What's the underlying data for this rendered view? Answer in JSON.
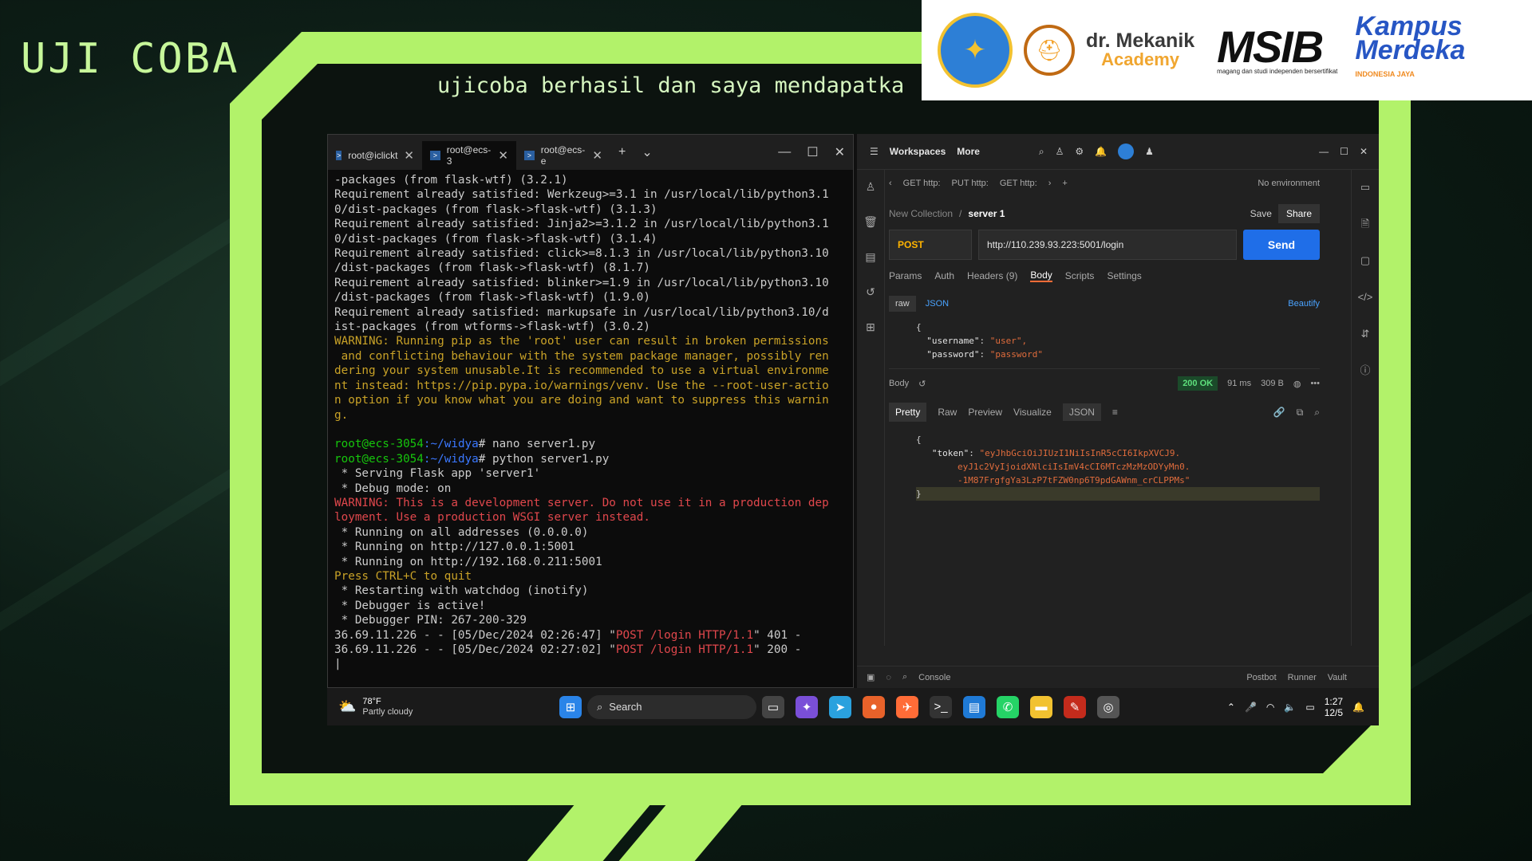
{
  "slide": {
    "title": "UJI COBA",
    "subtitle": "ujicoba berhasil dan saya mendapatka",
    "logos": {
      "mekanik_line1": "dr. Mekanik",
      "mekanik_line2": "Academy",
      "msib": "MSIB",
      "msib_tagline": "magang dan studi independen bersertifikat",
      "kampus_line1": "Kampus",
      "kampus_line2": "Merdeka",
      "kampus_tagline": "INDONESIA JAYA"
    }
  },
  "terminal": {
    "tabs": [
      {
        "label": "root@iclickt"
      },
      {
        "label": "root@ecs-3"
      },
      {
        "label": "root@ecs-e"
      }
    ],
    "lines": [
      {
        "text": "-packages (from flask-wtf) (3.2.1)",
        "style": ""
      },
      {
        "text": "Requirement already satisfied: Werkzeug>=3.1 in /usr/local/lib/python3.1",
        "style": ""
      },
      {
        "text": "0/dist-packages (from flask->flask-wtf) (3.1.3)",
        "style": ""
      },
      {
        "text": "Requirement already satisfied: Jinja2>=3.1.2 in /usr/local/lib/python3.1",
        "style": ""
      },
      {
        "text": "0/dist-packages (from flask->flask-wtf) (3.1.4)",
        "style": ""
      },
      {
        "text": "Requirement already satisfied: click>=8.1.3 in /usr/local/lib/python3.10",
        "style": ""
      },
      {
        "text": "/dist-packages (from flask->flask-wtf) (8.1.7)",
        "style": ""
      },
      {
        "text": "Requirement already satisfied: blinker>=1.9 in /usr/local/lib/python3.10",
        "style": ""
      },
      {
        "text": "/dist-packages (from flask->flask-wtf) (1.9.0)",
        "style": ""
      },
      {
        "text": "Requirement already satisfied: markupsafe in /usr/local/lib/python3.10/d",
        "style": ""
      },
      {
        "text": "ist-packages (from wtforms->flask-wtf) (3.0.2)",
        "style": ""
      },
      {
        "text": "WARNING: Running pip as the 'root' user can result in broken permissions",
        "style": "warn"
      },
      {
        "text": " and conflicting behaviour with the system package manager, possibly ren",
        "style": "warn"
      },
      {
        "text": "dering your system unusable.It is recommended to use a virtual environme",
        "style": "warn"
      },
      {
        "text": "nt instead: https://pip.pypa.io/warnings/venv. Use the --root-user-actio",
        "style": "warn"
      },
      {
        "text": "n option if you know what you are doing and want to suppress this warnin",
        "style": "warn"
      },
      {
        "text": "g.",
        "style": "warn"
      },
      {
        "text": "",
        "style": ""
      },
      {
        "prompt_user": "root@ecs-3054",
        "prompt_path": ":~/widya",
        "text": "# nano server1.py",
        "style": "prompt"
      },
      {
        "prompt_user": "root@ecs-3054",
        "prompt_path": ":~/widya",
        "text": "# python server1.py",
        "style": "prompt"
      },
      {
        "text": " * Serving Flask app 'server1'",
        "style": ""
      },
      {
        "text": " * Debug mode: on",
        "style": ""
      },
      {
        "text": "WARNING: This is a development server. Do not use it in a production dep",
        "style": "red"
      },
      {
        "text": "loyment. Use a production WSGI server instead.",
        "style": "red"
      },
      {
        "text": " * Running on all addresses (0.0.0.0)",
        "style": ""
      },
      {
        "text": " * Running on http://127.0.0.1:5001",
        "style": ""
      },
      {
        "text": " * Running on http://192.168.0.211:5001",
        "style": ""
      },
      {
        "text": "Press CTRL+C to quit",
        "style": "warn"
      },
      {
        "text": " * Restarting with watchdog (inotify)",
        "style": ""
      },
      {
        "text": " * Debugger is active!",
        "style": ""
      },
      {
        "text": " * Debugger PIN: 267-200-329",
        "style": ""
      },
      {
        "pre": "36.69.11.226 - - [05/Dec/2024 02:26:47] \"",
        "req": "POST /login HTTP/1.1",
        "post": "\" 401 -",
        "style": "log"
      },
      {
        "pre": "36.69.11.226 - - [05/Dec/2024 02:27:02] \"",
        "req": "POST /login HTTP/1.1",
        "post": "\" 200 -",
        "style": "log"
      }
    ]
  },
  "postman": {
    "workspaces": "Workspaces",
    "more": "More",
    "req_tabs": [
      "GET http:",
      "PUT http:",
      "GET http:"
    ],
    "environment": "No environment",
    "breadcrumb_collection": "New Collection",
    "breadcrumb_sep": "/",
    "breadcrumb_request": "server 1",
    "save": "Save",
    "share": "Share",
    "method": "POST",
    "url": "http://110.239.93.223:5001/login",
    "send": "Send",
    "subtabs": [
      "Params",
      "Auth",
      "Headers (9)",
      "Body",
      "Scripts",
      "Settings"
    ],
    "body_mode": "raw",
    "body_format": "JSON",
    "beautify": "Beautify",
    "request_body": {
      "line1": "{",
      "line2_key": "\"username\"",
      "line2_val": "\"user\",",
      "line3_key": "\"password\"",
      "line3_val": "\"password\""
    },
    "response": {
      "label": "Body",
      "status": "200 OK",
      "time": "91 ms",
      "size": "309 B",
      "tabs": [
        "Pretty",
        "Raw",
        "Preview",
        "Visualize"
      ],
      "format": "JSON",
      "token_key": "\"token\"",
      "token_1": "\"eyJhbGciOiJIUzI1NiIsInR5cCI6IkpXVCJ9.",
      "token_2": "eyJ1c2VyIjoidXNlciIsImV4cCI6MTczMzMzODYyMn0.",
      "token_3": "-1M87FrgfgYa3LzP7tFZW0np6T9pdGAWnm_crCLPPMs\""
    },
    "status_bar": {
      "console": "Console",
      "postbot": "Postbot",
      "runner": "Runner",
      "vault": "Vault"
    }
  },
  "taskbar": {
    "weather_temp": "78°F",
    "weather_desc": "Partly cloudy",
    "search": "Search",
    "time": "1:27",
    "date": "12/5"
  }
}
